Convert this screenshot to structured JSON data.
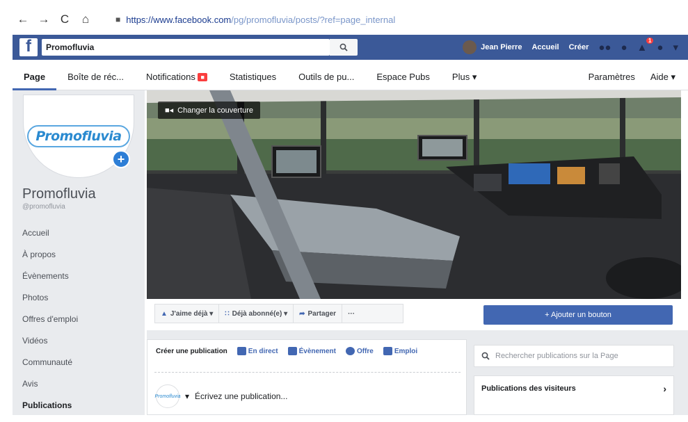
{
  "browser": {
    "back": "←",
    "forward": "→",
    "reload": "C",
    "home": "⌂",
    "lock": "🔒",
    "url_host": "https://www.facebook.com",
    "url_path": "/pg/promofluvia/posts/?ref=page_internal"
  },
  "fb_header": {
    "logo": "f",
    "search_value": "Promofluvia",
    "search_icon": "🔍",
    "user_name": "Jean Pierre",
    "links": [
      "Accueil",
      "Créer"
    ],
    "notification_count": "1",
    "icons": [
      "friends-icon",
      "messenger-icon",
      "notifications-icon",
      "help-icon",
      "dropdown-icon"
    ]
  },
  "page_tabs": {
    "tabs": [
      "Page",
      "Boîte de réc...",
      "Notifications",
      "Statistiques",
      "Outils de pu...",
      "Espace Pubs",
      "Plus ▾"
    ],
    "right": [
      "Paramètres",
      "Aide ▾"
    ]
  },
  "sidebar": {
    "logo_text": "Promofluvia",
    "add_photo": "+",
    "page_name": "Promofluvia",
    "page_handle": "@promofluvia",
    "items": [
      "Accueil",
      "À propos",
      "Évènements",
      "Photos",
      "Offres d'emploi",
      "Vidéos",
      "Communauté",
      "Avis",
      "Publications"
    ]
  },
  "cover": {
    "change_label": "Changer la couverture",
    "camera_icon": "■◂"
  },
  "actions": {
    "like": "J'aime déjà ▾",
    "follow": "Déjà abonné(e) ▾",
    "share": "Partager",
    "more": "···",
    "add_button": "+ Ajouter un bouton"
  },
  "composer": {
    "create_label": "Créer une publication",
    "live": "En direct",
    "event": "Évènement",
    "offer": "Offre",
    "job": "Emploi",
    "placeholder": "Écrivez une publication...",
    "avatar_text": "Promofluvia"
  },
  "right_panel": {
    "search_placeholder": "Rechercher publications sur la Page",
    "visitors_title": "Publications des visiteurs",
    "visitors_chevron": "›"
  },
  "colors": {
    "fb_blue": "#3b5998",
    "button_blue": "#4267b2",
    "badge_red": "#fa3e3e"
  }
}
